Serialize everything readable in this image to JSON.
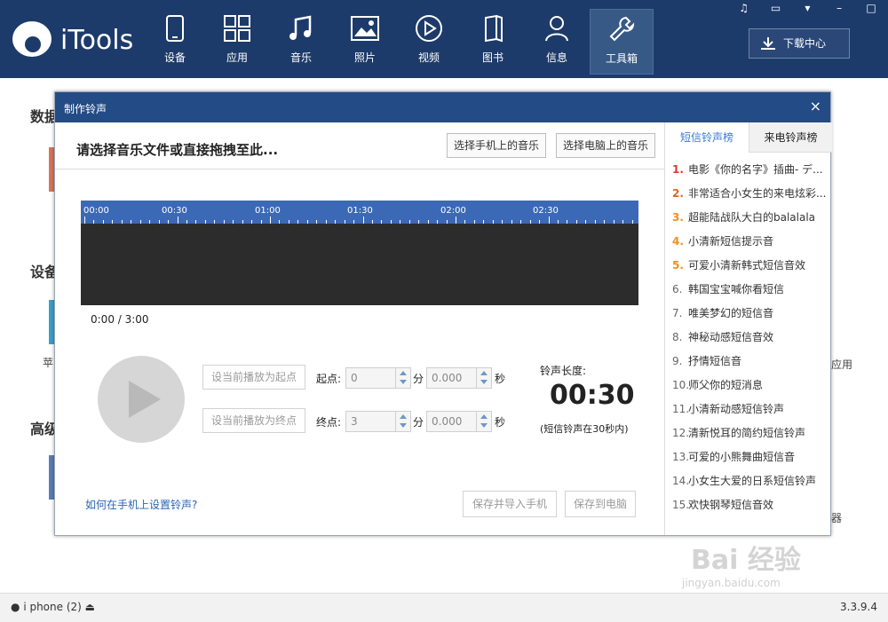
{
  "app": {
    "brand": "iTools"
  },
  "nav": [
    {
      "label": "设备",
      "icon": "phone-icon"
    },
    {
      "label": "应用",
      "icon": "apps-grid-icon"
    },
    {
      "label": "音乐",
      "icon": "music-note-icon"
    },
    {
      "label": "照片",
      "icon": "photo-icon"
    },
    {
      "label": "视频",
      "icon": "play-circle-icon"
    },
    {
      "label": "图书",
      "icon": "book-icon"
    },
    {
      "label": "信息",
      "icon": "person-icon"
    },
    {
      "label": "工具箱",
      "icon": "wrench-icon",
      "active": true
    }
  ],
  "window_controls": [
    "♫",
    "▭",
    "▾",
    "–",
    "□"
  ],
  "download_center": "下载中心",
  "background": {
    "sections": [
      "数据",
      "设备",
      "高级"
    ],
    "side_labels": [
      "苹",
      "应用",
      "器"
    ]
  },
  "status": {
    "device": "i phone",
    "count": "(2)",
    "version": "3.3.9.4"
  },
  "dialog": {
    "title": "制作铃声",
    "close": "×",
    "prompt": "请选择音乐文件或直接拖拽至此...",
    "btn_phone_music": "选择手机上的音乐",
    "btn_pc_music": "选择电脑上的音乐",
    "timeline_ticks": [
      "00:00",
      "00:30",
      "01:00",
      "01:30",
      "02:00",
      "02:30"
    ],
    "time_position": "0:00 / 3:00",
    "set_start": "设当前播放为起点",
    "set_end": "设当前播放为终点",
    "start_label": "起点:",
    "end_label": "终点:",
    "minute_label": "分",
    "second_label": "秒",
    "start_min": "0",
    "start_sec": "0.000",
    "end_min": "3",
    "end_sec": "0.000",
    "ringtone_len_label": "铃声长度:",
    "ringtone_len_value": "00:30",
    "ringtone_note": "(短信铃声在30秒内)",
    "howto_link": "如何在手机上设置铃声?",
    "save_import": "保存并导入手机",
    "save_pc": "保存到电脑"
  },
  "rank": {
    "tab_sms": "短信铃声榜",
    "tab_call": "来电铃声榜",
    "items": [
      {
        "n": "1.",
        "t": "电影《你的名字》插曲- デ..."
      },
      {
        "n": "2.",
        "t": "非常适合小女生的来电炫彩..."
      },
      {
        "n": "3.",
        "t": "超能陆战队大白的balalala"
      },
      {
        "n": "4.",
        "t": "小清新短信提示音"
      },
      {
        "n": "5.",
        "t": "可爱小清新韩式短信音效"
      },
      {
        "n": "6.",
        "t": "韩国宝宝喊你看短信"
      },
      {
        "n": "7.",
        "t": "唯美梦幻的短信音"
      },
      {
        "n": "8.",
        "t": "神秘动感短信音效"
      },
      {
        "n": "9.",
        "t": "抒情短信音"
      },
      {
        "n": "10.",
        "t": "师父你的短消息"
      },
      {
        "n": "11.",
        "t": "小清新动感短信铃声"
      },
      {
        "n": "12.",
        "t": "清新悦耳的简约短信铃声"
      },
      {
        "n": "13.",
        "t": "可爱的小熊舞曲短信音"
      },
      {
        "n": "14.",
        "t": "小女生大爱的日系短信铃声"
      },
      {
        "n": "15.",
        "t": "欢快钢琴短信音效"
      }
    ]
  },
  "watermark": {
    "big": "Bai 经验",
    "small": "jingyan.baidu.com"
  }
}
